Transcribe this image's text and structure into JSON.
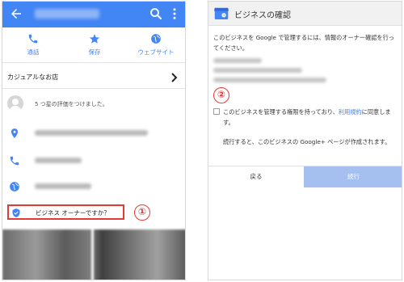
{
  "left": {
    "actions": [
      {
        "label": "通話",
        "icon": "phone-icon"
      },
      {
        "label": "保存",
        "icon": "star-icon"
      },
      {
        "label": "ウェブサイト",
        "icon": "globe-icon"
      }
    ],
    "category": "カジュアルなお店",
    "rating_prompt": "5 つ星の評価をつけました。",
    "owner_prompt": "ビジネス オーナーですか？",
    "callout_number": "①"
  },
  "right": {
    "title": "ビジネスの確認",
    "intro": "このビジネスを Google で管理するには、情報のオーナー確認を行ってください。",
    "callout_number": "②",
    "agree_text": "このビジネスを管理する権限を持っており、",
    "agree_link": "利用規約",
    "agree_suffix": "に同意します。",
    "continue_note": "続行すると、このビジネスの Google+ ページが作成されます。",
    "back_button": "戻る",
    "continue_button": "続行"
  },
  "colors": {
    "accent": "#4285f4",
    "callout": "#e53935",
    "disabled_button": "#a5bfef"
  }
}
